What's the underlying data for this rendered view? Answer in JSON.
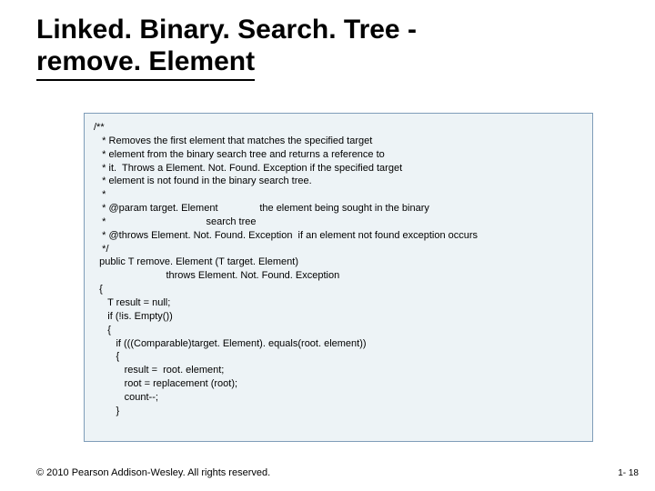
{
  "title": {
    "line1": "Linked. Binary. Search. Tree -",
    "line2": "remove. Element"
  },
  "code": {
    "l0": "/**",
    "l1": "   * Removes the first element that matches the specified target",
    "l2": "   * element from the binary search tree and returns a reference to",
    "l3": "   * it.  Throws a Element. Not. Found. Exception if the specified target",
    "l4": "   * element is not found in the binary search tree.",
    "l5": "   *",
    "l6": "   * @param target. Element               the element being sought in the binary",
    "l7": "   *                                    search tree",
    "l8": "   * @throws Element. Not. Found. Exception  if an element not found exception occurs",
    "l9": "   */",
    "l10": "  public T remove. Element (T target. Element)",
    "l11": "                          throws Element. Not. Found. Exception",
    "l12": "  {",
    "l13": "     T result = null;",
    "l14": "     if (!is. Empty())",
    "l15": "     {",
    "l16": "        if (((Comparable)target. Element). equals(root. element))",
    "l17": "        {",
    "l18": "           result =  root. element;",
    "l19": "           root = replacement (root);",
    "l20": "           count--;",
    "l21": "        }"
  },
  "footer": {
    "copyright": "© 2010 Pearson Addison-Wesley. All rights reserved.",
    "pagenum": "1- 18"
  }
}
